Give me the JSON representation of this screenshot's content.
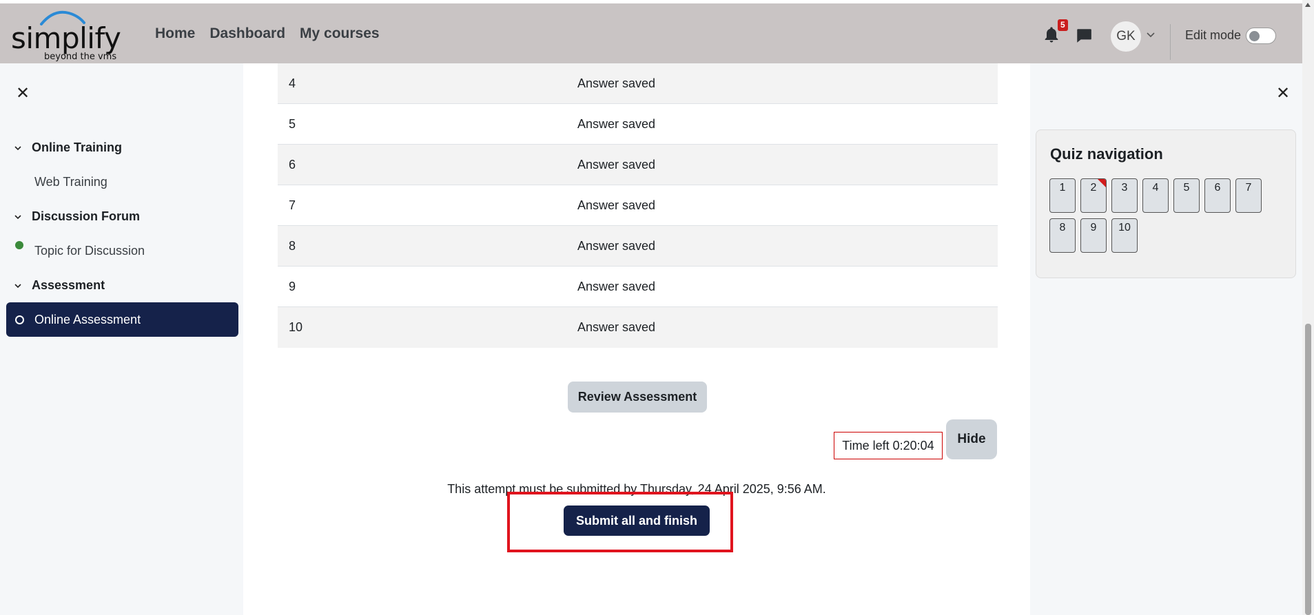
{
  "brand": {
    "name": "simplify",
    "tagline": "beyond the vms",
    "arc_color": "#2a8ad6"
  },
  "navbar": {
    "links": [
      "Home",
      "Dashboard",
      "My courses"
    ],
    "notifications_count": "5",
    "avatar_initials": "GK",
    "edit_mode_label": "Edit mode",
    "edit_mode_on": false
  },
  "left_drawer": {
    "sections": [
      {
        "title": "Online Training",
        "items": [
          {
            "label": "Web Training",
            "status": "completed"
          }
        ]
      },
      {
        "title": "Discussion Forum",
        "items": [
          {
            "label": "Topic for Discussion",
            "status": "none"
          }
        ]
      },
      {
        "title": "Assessment",
        "items": [
          {
            "label": "Online Assessment",
            "status": "active"
          }
        ]
      }
    ]
  },
  "summary_table": {
    "rows": [
      {
        "question": "4",
        "status": "Answer saved"
      },
      {
        "question": "5",
        "status": "Answer saved"
      },
      {
        "question": "6",
        "status": "Answer saved"
      },
      {
        "question": "7",
        "status": "Answer saved"
      },
      {
        "question": "8",
        "status": "Answer saved"
      },
      {
        "question": "9",
        "status": "Answer saved"
      },
      {
        "question": "10",
        "status": "Answer saved"
      }
    ]
  },
  "actions": {
    "review_label": "Review Assessment",
    "timer_text": "Time left 0:20:04",
    "hide_label": "Hide",
    "deadline_text": "This attempt must be submitted by Thursday, 24 April 2025, 9:56 AM.",
    "submit_label": "Submit all and finish"
  },
  "quiz_navigation": {
    "title": "Quiz navigation",
    "buttons": [
      {
        "label": "1",
        "flagged": false
      },
      {
        "label": "2",
        "flagged": true
      },
      {
        "label": "3",
        "flagged": false
      },
      {
        "label": "4",
        "flagged": false
      },
      {
        "label": "5",
        "flagged": false
      },
      {
        "label": "6",
        "flagged": false
      },
      {
        "label": "7",
        "flagged": false
      },
      {
        "label": "8",
        "flagged": false
      },
      {
        "label": "9",
        "flagged": false
      },
      {
        "label": "10",
        "flagged": false
      }
    ]
  },
  "colors": {
    "navbar_bg": "#c9c4c4",
    "primary_dark": "#15224a",
    "highlight_red": "#e0141e",
    "completed_green": "#3b8a3b"
  }
}
